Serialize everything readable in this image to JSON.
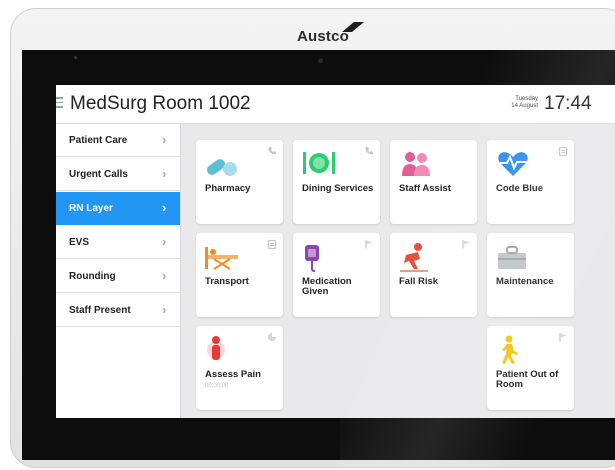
{
  "device": {
    "brand": "Austco",
    "colors": {
      "accent": "#2196f3",
      "bezel": "#0d0d0d"
    }
  },
  "header": {
    "room_title": "MedSurg Room 1002",
    "day": "Tuesday",
    "date": "14 August",
    "time": "17:44"
  },
  "sidebar": {
    "items": [
      {
        "label": "Patient Care",
        "icon": "chevron-right-icon"
      },
      {
        "label": "Urgent Calls",
        "icon": "chevron-right-icon"
      },
      {
        "label": "RN Layer",
        "icon": "chevron-right-icon",
        "active": true
      },
      {
        "label": "EVS",
        "icon": "chevron-right-icon"
      },
      {
        "label": "Rounding",
        "icon": "chevron-right-icon"
      },
      {
        "label": "Staff Present",
        "icon": "chevron-right-icon"
      }
    ]
  },
  "tiles": [
    {
      "label": "Pharmacy",
      "icon": "pills-icon",
      "corner": "phone-icon",
      "color": "#5bc0d8"
    },
    {
      "label": "Dining Services",
      "icon": "dining-icon",
      "corner": "phone-icon",
      "color": "#2ecc71"
    },
    {
      "label": "Staff Assist",
      "icon": "staff-icon",
      "corner": "",
      "color": "#e35d9a"
    },
    {
      "label": "Code Blue",
      "icon": "heart-pulse-icon",
      "corner": "clipboard-icon",
      "color": "#2f8fe6"
    },
    {
      "label": "Transport",
      "icon": "stretcher-icon",
      "corner": "clipboard-icon",
      "color": "#f28c28"
    },
    {
      "label": "Medication Given",
      "icon": "iv-bag-icon",
      "corner": "flag-icon",
      "color": "#8e44ad"
    },
    {
      "label": "Fall Risk",
      "icon": "fall-icon",
      "corner": "flag-icon",
      "color": "#e74c3c"
    },
    {
      "label": "Maintenance",
      "icon": "toolbox-icon",
      "corner": "",
      "color": "#95a5a6"
    },
    {
      "label": "Assess Pain",
      "sublabel": "00:00:00",
      "icon": "pain-icon",
      "corner": "timer-icon",
      "color": "#e53935"
    },
    {
      "label": "Patient Out of Room",
      "icon": "walking-icon",
      "corner": "flag-icon",
      "color": "#f1c40f"
    }
  ]
}
